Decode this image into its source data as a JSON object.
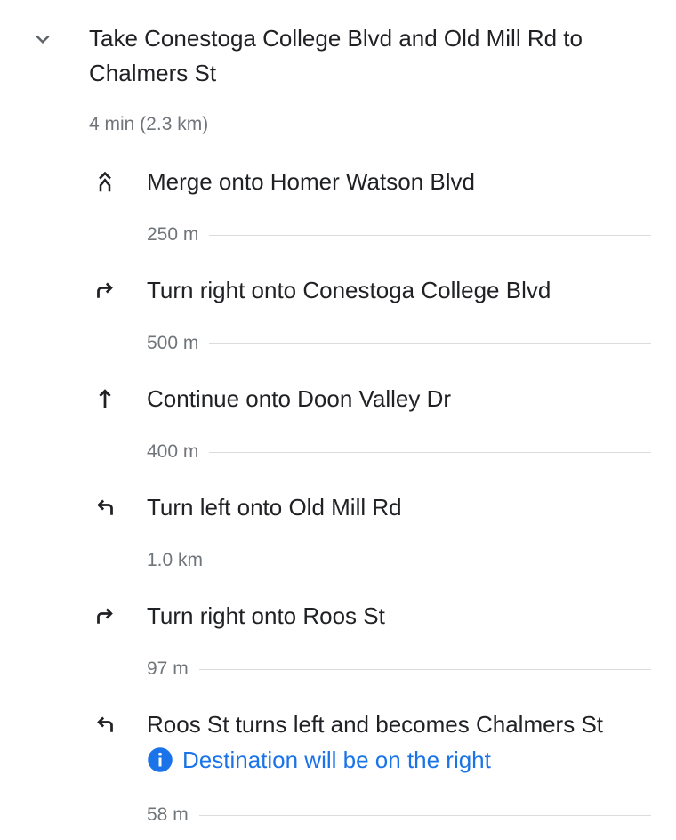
{
  "section": {
    "title": "Take Conestoga College Blvd and Old Mill Rd to Chalmers St",
    "summary": "4 min (2.3 km)",
    "expand_icon": "chevron-down-icon"
  },
  "steps": [
    {
      "icon": "merge-icon",
      "instruction": "Merge onto Homer Watson Blvd",
      "distance": "250 m"
    },
    {
      "icon": "turn-right-icon",
      "instruction": "Turn right onto Conestoga College Blvd",
      "distance": "500 m"
    },
    {
      "icon": "straight-icon",
      "instruction": "Continue onto Doon Valley Dr",
      "distance": "400 m"
    },
    {
      "icon": "turn-left-icon",
      "instruction": "Turn left onto Old Mill Rd",
      "distance": "1.0 km"
    },
    {
      "icon": "turn-right-icon",
      "instruction": "Turn right onto Roos St",
      "distance": "97 m"
    },
    {
      "icon": "turn-left-icon",
      "instruction": "Roos St turns left and becomes Chalmers St",
      "note": "Destination will be on the right",
      "note_icon": "info-icon",
      "distance": "58 m"
    }
  ],
  "colors": {
    "text": "#202124",
    "secondary": "#70757a",
    "link": "#1a73e8",
    "divider": "#dadce0"
  }
}
